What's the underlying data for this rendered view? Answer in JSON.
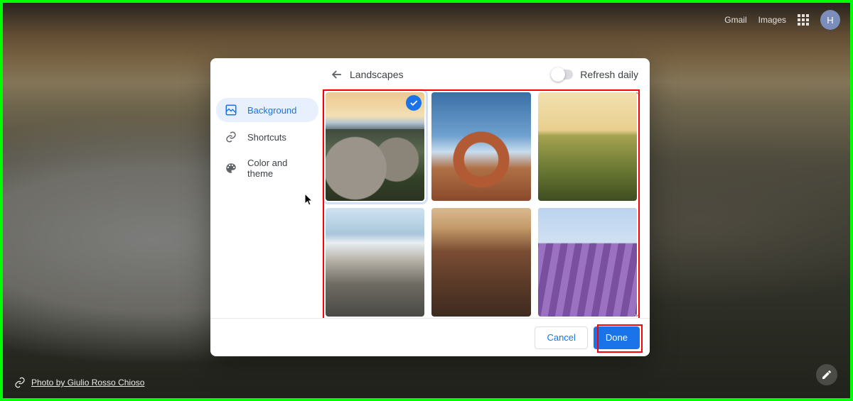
{
  "topbar": {
    "gmail": "Gmail",
    "images": "Images",
    "avatar_initial": "H"
  },
  "attribution": {
    "label": "Photo by Giulio Rosso Chioso"
  },
  "modal": {
    "sidebar": {
      "background": "Background",
      "shortcuts": "Shortcuts",
      "color_theme": "Color and theme"
    },
    "header": {
      "title": "Landscapes",
      "refresh_label": "Refresh daily",
      "refresh_on": false
    },
    "gallery": {
      "items": [
        {
          "name": "rocky-tidepools-sunset",
          "selected": true
        },
        {
          "name": "sandstone-arch",
          "selected": false
        },
        {
          "name": "plateau-grassland-sunset",
          "selected": false
        },
        {
          "name": "snowy-mountain-valley",
          "selected": false
        },
        {
          "name": "red-canyon",
          "selected": false
        },
        {
          "name": "lavender-field-lone-tree",
          "selected": false
        }
      ]
    },
    "footer": {
      "cancel": "Cancel",
      "done": "Done"
    }
  }
}
